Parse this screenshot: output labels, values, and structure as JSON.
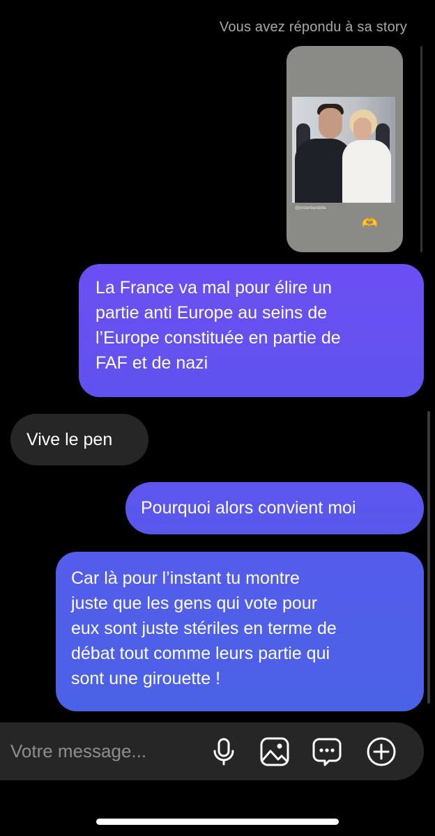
{
  "thread": {
    "story_reply_label": "Vous avez répondu à sa story",
    "story": {
      "handle": "@jordanbardella",
      "emoji": "🫶"
    },
    "messages": [
      {
        "direction": "outgoing",
        "lines": [
          "La France va mal pour élire un",
          "partie anti Europe au seins de",
          "l’Europe constituée en partie de",
          "FAF et de nazi"
        ]
      },
      {
        "direction": "incoming",
        "text": "Vive le pen"
      },
      {
        "direction": "outgoing",
        "text": "Pourquoi alors convient moi"
      },
      {
        "direction": "outgoing",
        "lines": [
          "Car là pour l’instant tu montre",
          "juste que les gens qui vote pour",
          "eux sont juste stériles en terme de",
          "débat tout comme leurs partie qui",
          "sont une girouette !"
        ]
      }
    ]
  },
  "composer": {
    "placeholder": "Votre message...",
    "icons": [
      "microphone-icon",
      "gallery-icon",
      "sticker-chat-icon",
      "plus-circle-icon"
    ]
  },
  "colors": {
    "background": "#000000",
    "outgoing_bubble_top": "#6c4ff2",
    "outgoing_bubble_bottom": "#4a62e6",
    "incoming_bubble": "#262626",
    "composer_bg": "#262626",
    "muted_text": "#a8a8a8"
  }
}
